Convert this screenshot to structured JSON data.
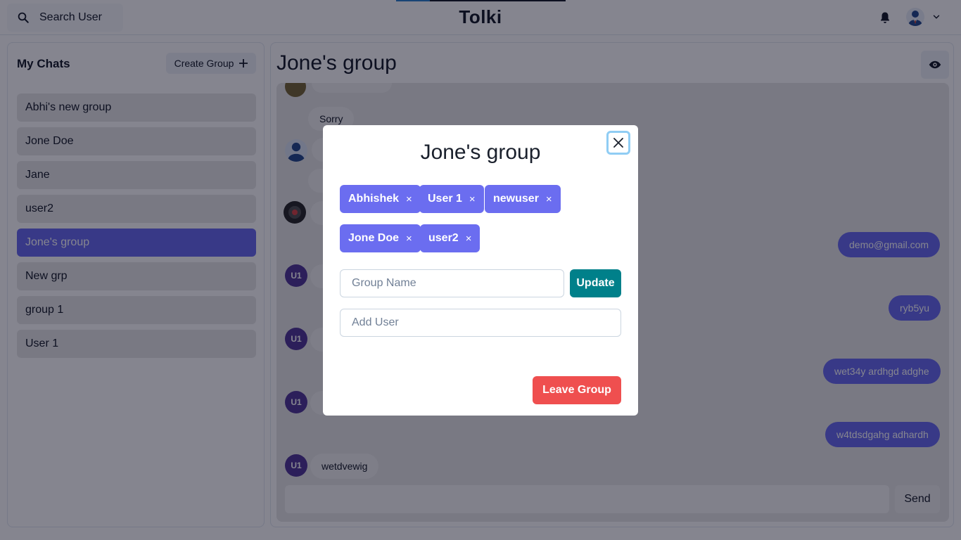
{
  "header": {
    "search_label": "Search User",
    "brand": "Tolki"
  },
  "sidebar": {
    "title": "My Chats",
    "create_group_label": "Create Group",
    "chats": [
      {
        "name": "Abhi's new group",
        "active": false
      },
      {
        "name": "Jone Doe",
        "active": false
      },
      {
        "name": "Jane",
        "active": false
      },
      {
        "name": "user2",
        "active": false
      },
      {
        "name": "Jone's group",
        "active": true
      },
      {
        "name": "New grp",
        "active": false
      },
      {
        "name": "group 1",
        "active": false
      },
      {
        "name": "User 1",
        "active": false
      }
    ]
  },
  "chat": {
    "title": "Jone's group",
    "send_label": "Send",
    "avatar_initials": "U1",
    "messages": [
      {
        "text": "Sorry",
        "side": "in"
      },
      {
        "text": "demo@gmail.com",
        "side": "out"
      },
      {
        "text": "ryb5yu",
        "side": "out"
      },
      {
        "text": "wet34y ardhgd adghe",
        "side": "out"
      },
      {
        "text": "w4tdsdgahg adhardh",
        "side": "out"
      },
      {
        "text": "wetdvewig",
        "side": "in"
      }
    ]
  },
  "modal": {
    "title": "Jone's group",
    "members": [
      "Abhishek",
      "User 1",
      "newuser",
      "Jone Doe",
      "user2"
    ],
    "remove_glyph": "×",
    "group_name_placeholder": "Group Name",
    "update_label": "Update",
    "add_user_placeholder": "Add User",
    "leave_label": "Leave Group"
  },
  "colors": {
    "accent": "#6b6df0",
    "update": "#00808a",
    "leave": "#ef4f4f",
    "avatar_u1": "#553c9a"
  }
}
